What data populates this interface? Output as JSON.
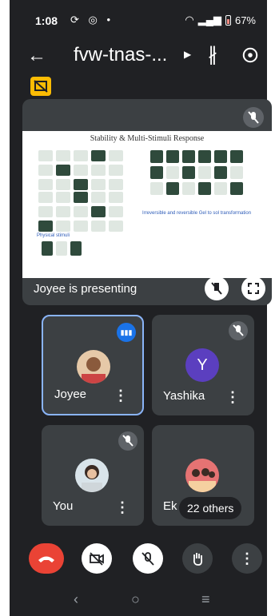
{
  "status_bar": {
    "time": "1:08",
    "battery": "67%"
  },
  "app_bar": {
    "meeting_code": "fvw-tnas-..."
  },
  "presentation": {
    "slide_title": "Stability & Multi-Stimuli Response",
    "slide_caption_left": "Physical stimuli",
    "slide_caption_right": "Irreversible and reversible Gel to sol transformation",
    "presenter_label": "Joyee is presenting"
  },
  "participants": [
    {
      "name": "Joyee",
      "speaking": true
    },
    {
      "name": "Yashika",
      "initial": "Y",
      "muted": true
    },
    {
      "name": "You",
      "muted": true
    },
    {
      "name": "Ek",
      "others_label": "22 others"
    }
  ],
  "colors": {
    "end_call": "#ea4335",
    "accent": "#8ab4f8",
    "avatar_y": "#5b3fbf",
    "caption_badge": "#fbbc04"
  },
  "icons": [
    "back-arrow-icon",
    "bluetooth-icon",
    "switch-camera-icon",
    "captions-off-icon",
    "mic-off-icon",
    "pin-off-icon",
    "fullscreen-icon",
    "more-vert-icon",
    "end-call-icon",
    "camera-off-icon",
    "raise-hand-icon"
  ]
}
